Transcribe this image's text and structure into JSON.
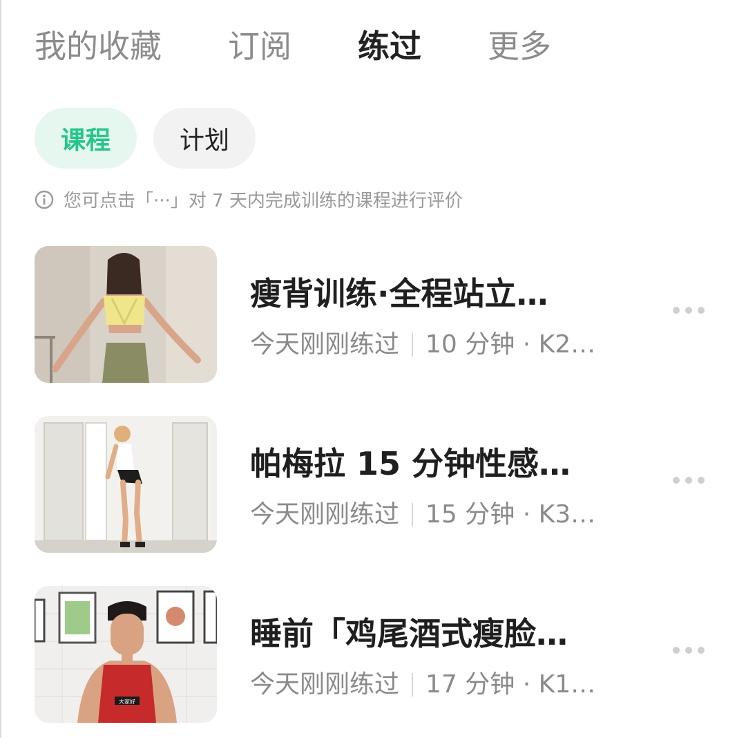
{
  "tabs": [
    {
      "label": "我的收藏"
    },
    {
      "label": "订阅"
    },
    {
      "label": "练过"
    },
    {
      "label": "更多"
    }
  ],
  "active_tab": "练过",
  "filters": [
    {
      "label": "课程"
    },
    {
      "label": "计划"
    }
  ],
  "active_filter": "课程",
  "hint": {
    "text": "您可点击「···」对 7 天内完成训练的课程进行评价",
    "icon": "info-icon"
  },
  "courses": [
    {
      "title": "瘦背训练·全程站立…",
      "status": "今天刚刚练过",
      "detail": "10 分钟 · K2…"
    },
    {
      "title": "帕梅拉 15 分钟性感…",
      "status": "今天刚刚练过",
      "detail": "15 分钟 · K3…"
    },
    {
      "title": "睡前「鸡尾酒式瘦脸…",
      "status": "今天刚刚练过",
      "detail": "17 分钟 · K1…",
      "thumb_caption": "大家好"
    }
  ],
  "colors": {
    "accent": "#24c789",
    "accent_bg": "#e6f7f0",
    "text_primary": "#1f1f1f",
    "text_secondary": "#8a8a8a"
  }
}
